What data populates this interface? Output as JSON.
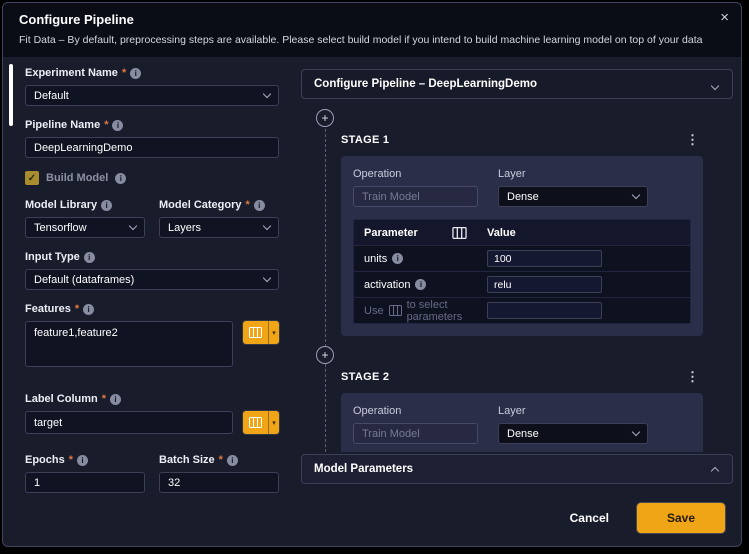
{
  "colors": {
    "accent": "#f0a517",
    "required_mark": "#e2793f",
    "modal_bg": "#191c2b",
    "header_bg": "#0b0d16",
    "card_bg": "#2b2e49"
  },
  "icons": {
    "close": "×",
    "info": "i",
    "required": "*",
    "check": "✓",
    "kebab": "⋮",
    "plus": "+",
    "caret": "▾"
  },
  "modal": {
    "title": "Configure Pipeline",
    "subtitle": "Fit Data – By default, preprocessing steps are available. Please select build model if you intend to build machine learning model on top of your data"
  },
  "form": {
    "experiment_name": {
      "label": "Experiment Name",
      "value": "Default"
    },
    "pipeline_name": {
      "label": "Pipeline Name",
      "value": "DeepLearningDemo"
    },
    "build_model": {
      "label": "Build Model",
      "checked": true
    },
    "model_library": {
      "label": "Model Library",
      "value": "Tensorflow"
    },
    "model_category": {
      "label": "Model Category",
      "value": "Layers"
    },
    "input_type": {
      "label": "Input Type",
      "value": "Default (dataframes)"
    },
    "features": {
      "label": "Features",
      "value": "feature1,feature2"
    },
    "label_column": {
      "label": "Label Column",
      "value": "target"
    },
    "epochs": {
      "label": "Epochs",
      "value": "1"
    },
    "batch_size": {
      "label": "Batch Size",
      "value": "32"
    }
  },
  "pipeline": {
    "header": "Configure Pipeline – DeepLearningDemo",
    "stage1": {
      "title": "STAGE 1",
      "operation_label": "Operation",
      "operation_value": "Train Model",
      "layer_label": "Layer",
      "layer_value": "Dense",
      "table": {
        "param_header": "Parameter",
        "value_header": "Value",
        "rows": [
          {
            "param": "units",
            "value": "100"
          },
          {
            "param": "activation",
            "value": "relu"
          }
        ],
        "hint_prefix": "Use",
        "hint_suffix": "to select parameters"
      }
    },
    "stage2": {
      "title": "STAGE 2",
      "operation_label": "Operation",
      "operation_value": "Train Model",
      "layer_label": "Layer",
      "layer_value": "Dense"
    },
    "model_parameters_label": "Model Parameters"
  },
  "footer": {
    "cancel": "Cancel",
    "save": "Save"
  }
}
